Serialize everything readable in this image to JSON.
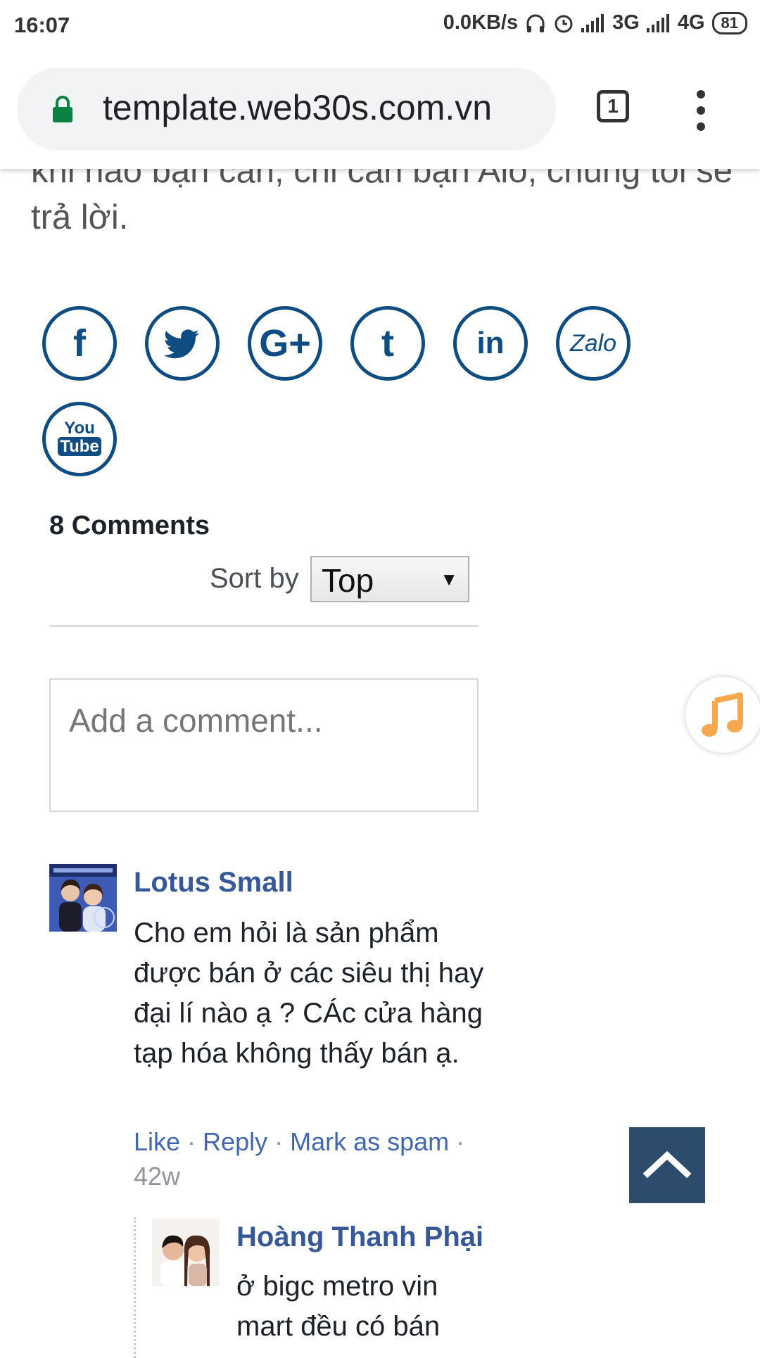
{
  "status_bar": {
    "time": "16:07",
    "network_speed": "0.0KB/s",
    "net_3g": "3G",
    "net_4g": "4G",
    "battery": "81"
  },
  "browser": {
    "url": "template.web30s.com.vn",
    "tab_count": "1"
  },
  "intro_text": "khi nào bạn cần, chỉ cần bạn Alo, chúng tôi sẽ trả lời.",
  "social": [
    {
      "name": "facebook",
      "glyph": "f"
    },
    {
      "name": "twitter",
      "glyph": ""
    },
    {
      "name": "google-plus",
      "glyph": "G+"
    },
    {
      "name": "tumblr",
      "glyph": "t"
    },
    {
      "name": "linkedin",
      "glyph": "in"
    },
    {
      "name": "zalo",
      "glyph": "Zalo"
    },
    {
      "name": "youtube",
      "glyph_top": "You",
      "glyph_bottom": "Tube"
    }
  ],
  "comments": {
    "count_label": "8 Comments",
    "sort_label": "Sort by",
    "sort_value": "Top",
    "add_placeholder": "Add a comment...",
    "items": [
      {
        "author": "Lotus Small",
        "text": "Cho em hỏi là sản phẩm được bán ở các siêu thị hay đại lí nào ạ ? CÁc cửa hàng tạp hóa không thấy bán ạ.",
        "like": "Like",
        "reply": "Reply",
        "spam": "Mark as spam",
        "time": "42w"
      },
      {
        "author": "Hoàng Thanh Phại",
        "text": "ở bigc metro vin mart đều có bán"
      }
    ]
  },
  "colors": {
    "social_blue": "#0f4c81",
    "link_blue": "#4267b2",
    "to_top_bg": "#2d4b6b",
    "music_orange": "#f7a84f"
  }
}
